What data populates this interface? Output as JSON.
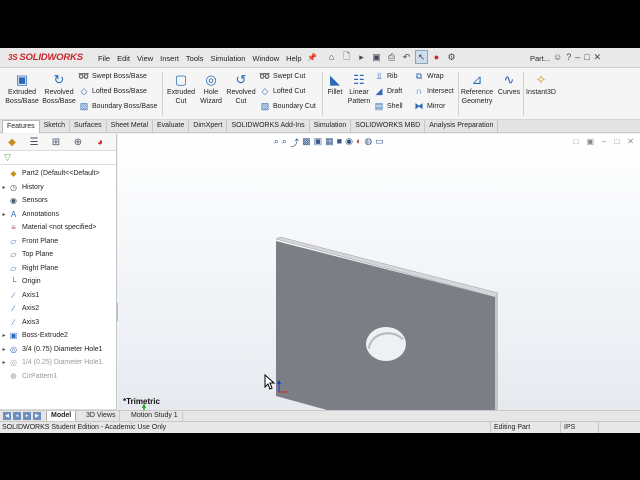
{
  "app": {
    "logo_mark": "3S",
    "logo_text": "SOLIDWORKS",
    "menu": [
      "File",
      "Edit",
      "View",
      "Insert",
      "Tools",
      "Simulation",
      "Window",
      "Help"
    ],
    "doc_name": "Part...",
    "quick_icons": [
      "home-icon",
      "new-icon",
      "open-icon",
      "save-icon",
      "print-icon",
      "undo-icon",
      "select-icon",
      "rebuild-icon",
      "options-icon"
    ],
    "help_icon": "?"
  },
  "commands": {
    "extruded_boss": "Extruded Boss/Base",
    "revolved_boss": "Revolved Boss/Base",
    "swept_boss": "Swept Boss/Base",
    "lofted_boss": "Lofted Boss/Base",
    "boundary_boss": "Boundary Boss/Base",
    "extruded_cut": "Extruded Cut",
    "hole_wizard": "Hole Wizard",
    "revolved_cut": "Revolved Cut",
    "swept_cut": "Swept Cut",
    "lofted_cut": "Lofted Cut",
    "boundary_cut": "Boundary Cut",
    "fillet": "Fillet",
    "linear_pattern": "Linear Pattern",
    "rib": "Rib",
    "draft": "Draft",
    "shell": "Shell",
    "wrap": "Wrap",
    "intersect": "Intersect",
    "mirror": "Mirror",
    "reference_geometry": "Reference Geometry",
    "curves": "Curves",
    "instant3d": "Instant3D"
  },
  "tabs": [
    "Features",
    "Sketch",
    "Surfaces",
    "Sheet Metal",
    "Evaluate",
    "DimXpert",
    "SOLIDWORKS Add-Ins",
    "Simulation",
    "SOLIDWORKS MBD",
    "Analysis Preparation"
  ],
  "active_tab": "Features",
  "tree": [
    {
      "label": "Part2  (Default<<Default>",
      "icon": "part-icon",
      "arrow": "",
      "grayed": false
    },
    {
      "label": "History",
      "icon": "history-icon",
      "arrow": "▸",
      "grayed": false
    },
    {
      "label": "Sensors",
      "icon": "sensor-icon",
      "arrow": "",
      "grayed": false
    },
    {
      "label": "Annotations",
      "icon": "annotation-icon",
      "arrow": "▸",
      "grayed": false
    },
    {
      "label": "Material <not specified>",
      "icon": "material-icon",
      "arrow": "",
      "grayed": false
    },
    {
      "label": "Front Plane",
      "icon": "plane-icon",
      "arrow": "",
      "grayed": false
    },
    {
      "label": "Top Plane",
      "icon": "plane-icon",
      "arrow": "",
      "grayed": false
    },
    {
      "label": "Right Plane",
      "icon": "plane-icon",
      "arrow": "",
      "grayed": false
    },
    {
      "label": "Origin",
      "icon": "origin-icon",
      "arrow": "",
      "grayed": false
    },
    {
      "label": "Axis1",
      "icon": "axis-icon",
      "arrow": "",
      "grayed": false
    },
    {
      "label": "Axis2",
      "icon": "axis-icon",
      "arrow": "",
      "grayed": false
    },
    {
      "label": "Axis3",
      "icon": "axis-icon",
      "arrow": "",
      "grayed": false
    },
    {
      "label": "Boss-Extrude2",
      "icon": "extrude-icon",
      "arrow": "▸",
      "grayed": false
    },
    {
      "label": "3/4 (0.75) Diameter Hole1",
      "icon": "hole-icon",
      "arrow": "▸",
      "grayed": false
    },
    {
      "label": "1/4 (0.25) Diameter Hole1",
      "icon": "hole-icon",
      "arrow": "▸",
      "grayed": true
    },
    {
      "label": "CirPattern1",
      "icon": "pattern-icon",
      "arrow": "",
      "grayed": true
    }
  ],
  "viewport": {
    "view_label": "*Trimetric"
  },
  "bottom_tabs": [
    "Model",
    "3D Views",
    "Motion Study 1"
  ],
  "status": {
    "message": "SOLIDWORKS Student Edition - Academic Use Only",
    "mode": "Editing Part",
    "units": "IPS"
  },
  "colors": {
    "brand": "#c8262c",
    "part_face": "#7a7d83",
    "part_top": "#c9cbcf",
    "axis_x": "#d22",
    "axis_y": "#2a2",
    "axis_z": "#23c"
  }
}
